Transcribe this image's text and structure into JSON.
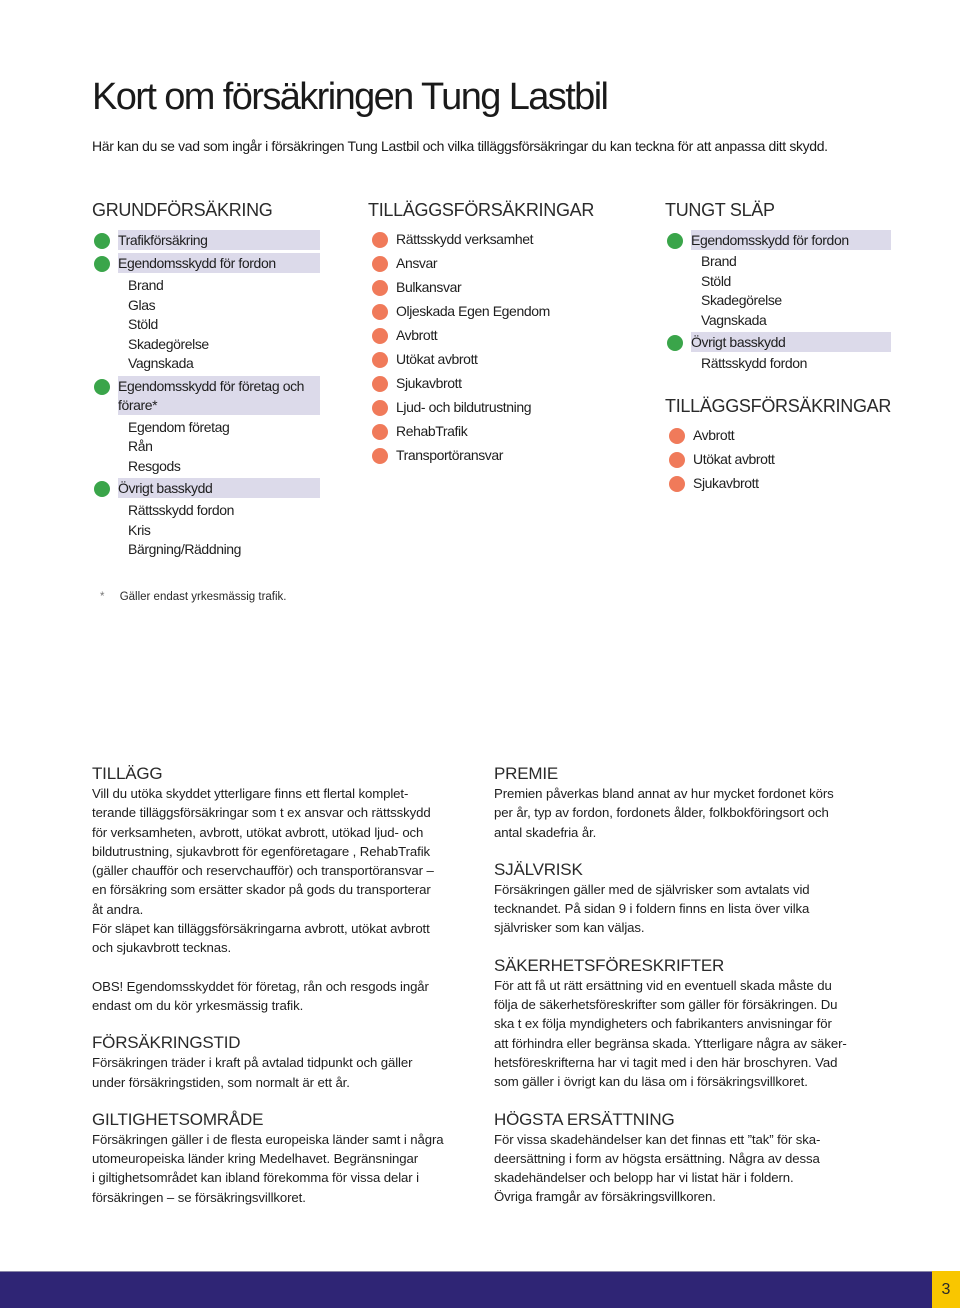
{
  "title": "Kort om försäkringen Tung Lastbil",
  "intro": "Här kan du se vad som ingår i försäkringen Tung Lastbil och vilka tilläggsförsäkringar du kan teckna för att anpassa ditt skydd.",
  "colors": {
    "included_bullet": "#3aa54a",
    "addon_bullet": "#f07a5a",
    "highlight_band": "#dcdaea",
    "footer_bar": "#2f2575",
    "page_number_bg": "#f9c600"
  },
  "grundforsakring": {
    "heading": "GRUNDFÖRSÄKRING",
    "groups": [
      {
        "label": "Trafikförsäkring",
        "icon": "green-bullet",
        "items": []
      },
      {
        "label": "Egendomsskydd för fordon",
        "icon": "green-bullet",
        "items": [
          "Brand",
          "Glas",
          "Stöld",
          "Skadegörelse",
          "Vagnskada"
        ]
      },
      {
        "label": "Egendomsskydd för företag och förare*",
        "icon": "green-bullet",
        "items": [
          "Egendom företag",
          "Rån",
          "Resgods"
        ]
      },
      {
        "label": "Övrigt basskydd",
        "icon": "green-bullet",
        "items": [
          "Rättsskydd fordon",
          "Kris",
          "Bärgning/Räddning"
        ]
      }
    ]
  },
  "tillaggsforsakringar": {
    "heading": "TILLÄGGSFÖRSÄKRINGAR",
    "items": [
      "Rättsskydd verksamhet",
      "Ansvar",
      "Bulkansvar",
      "Oljeskada Egen Egendom",
      "Avbrott",
      "Utökat avbrott",
      "Sjukavbrott",
      "Ljud- och bildutrustning",
      "RehabTrafik",
      "Transportöransvar"
    ]
  },
  "tungt_slap": {
    "heading": "TUNGT SLÄP",
    "groups": [
      {
        "label": "Egendomsskydd för fordon",
        "icon": "green-bullet",
        "items": [
          "Brand",
          "Stöld",
          "Skadegörelse",
          "Vagnskada"
        ]
      },
      {
        "label": "Övrigt basskydd",
        "icon": "green-bullet",
        "items": [
          "Rättsskydd fordon"
        ]
      }
    ],
    "addons_heading": "TILLÄGGSFÖRSÄKRINGAR",
    "addons": [
      "Avbrott",
      "Utökat avbrott",
      "Sjukavbrott"
    ]
  },
  "footnote": {
    "marker": "*",
    "text": "Gäller endast yrkesmässig trafik."
  },
  "sections_left": [
    {
      "heading": "TILLÄGG",
      "body": "Vill du utöka skyddet ytterligare finns ett flertal komplet-\nterande tilläggsförsäkringar som t ex ansvar och rättsskydd\nför verksamheten, avbrott, utökat avbrott, utökad ljud- och\nbildutrustning, sjukavbrott för egenföretagare , RehabTrafik\n(gäller chaufför och reservchaufför) och transportöransvar –\nen försäkring som ersätter skador på gods du transporterar\nåt andra.\nFör släpet kan tilläggsförsäkringarna avbrott, utökat avbrott\noch sjukavbrott tecknas.",
      "note": "OBS! Egendomsskyddet för företag, rån och resgods ingår\nendast om du kör yrkesmässig trafik."
    },
    {
      "heading": "FÖRSÄKRINGSTID",
      "body": "Försäkringen träder i kraft på avtalad tidpunkt och gäller\nunder försäkringstiden, som normalt är ett år."
    },
    {
      "heading": "GILTIGHETSOMRÅDE",
      "body": "Försäkringen gäller i de flesta europeiska länder samt i några\nutomeuropeiska länder kring Medelhavet. Begränsningar\ni giltighetsområdet kan ibland förekomma för vissa delar i\nförsäkringen – se försäkringsvillkoret."
    }
  ],
  "sections_right": [
    {
      "heading": "PREMIE",
      "body": "Premien påverkas bland annat av hur mycket fordonet körs\nper år, typ av fordon, fordonets ålder, folkbokföringsort och\nantal skadefria år."
    },
    {
      "heading": "SJÄLVRISK",
      "body": "Försäkringen gäller med de självrisker som avtalats vid\ntecknandet. På sidan 9 i foldern finns en lista över vilka\nsjälvrisker som kan väljas."
    },
    {
      "heading": "SÄKERHETSFÖRESKRIFTER",
      "body": "För att få ut rätt ersättning vid en eventuell skada måste du\nfölja de säkerhetsföreskrifter som gäller för försäkringen. Du\nska t ex följa myndigheters och fabrikanters anvisningar för\natt förhindra eller begränsa skada. Ytterligare några av säker-\nhetsföreskrifterna har vi tagit med i den här broschyren. Vad\nsom gäller i övrigt kan du läsa om i försäkringsvillkoret."
    },
    {
      "heading": "HÖGSTA ERSÄTTNING",
      "body": "För vissa skadehändelser kan det finnas ett ”tak” för ska-\ndeersättning i form av högsta ersättning. Några av dessa\nskadehändelser och belopp har vi listat här i foldern.\nÖvriga framgår av försäkringsvillkoren."
    }
  ],
  "page_number": "3"
}
